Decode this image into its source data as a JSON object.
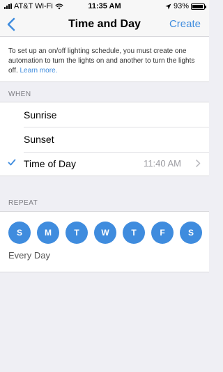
{
  "status_bar": {
    "carrier": "AT&T Wi-Fi",
    "time": "11:35 AM",
    "battery": "93%",
    "battery_level": 0.93,
    "icons": [
      "signal-bars-icon",
      "wifi-icon",
      "location-arrow-icon",
      "battery-icon"
    ]
  },
  "nav": {
    "title": "Time and Day",
    "create_label": "Create",
    "back_icon": "chevron-left-icon"
  },
  "intro": {
    "text": "To set up an on/off lighting schedule, you must create one automation to turn the lights on and another to turn the lights off.",
    "link": "Learn more."
  },
  "when": {
    "header": "WHEN",
    "options": [
      {
        "label": "Sunrise",
        "selected": false
      },
      {
        "label": "Sunset",
        "selected": false
      },
      {
        "label": "Time of Day",
        "selected": true,
        "value": "11:40 AM"
      }
    ]
  },
  "repeat": {
    "header": "REPEAT",
    "days": [
      "S",
      "M",
      "T",
      "W",
      "T",
      "F",
      "S"
    ],
    "summary": "Every Day"
  },
  "colors": {
    "accent": "#3f8cde",
    "background": "#efeff4"
  }
}
